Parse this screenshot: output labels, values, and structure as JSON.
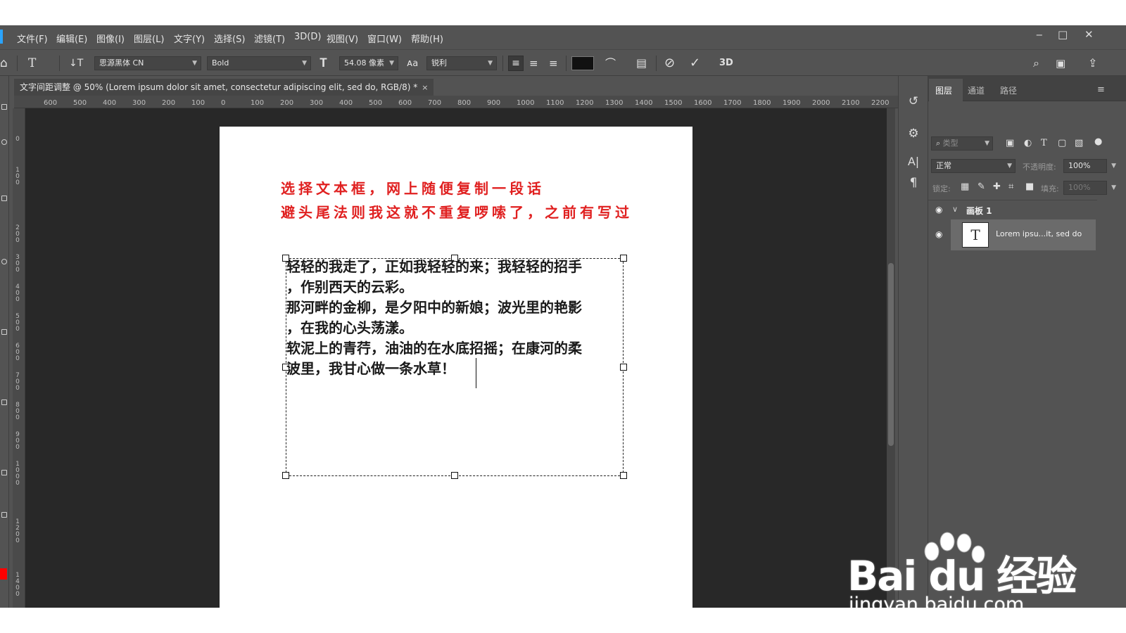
{
  "menubar": {
    "items": [
      "文件(F)",
      "编辑(E)",
      "图像(I)",
      "图层(L)",
      "文字(Y)",
      "选择(S)",
      "滤镜(T)",
      "3D(D)",
      "视图(V)",
      "窗口(W)",
      "帮助(H)"
    ],
    "window_controls": [
      "minimize-icon",
      "maximize-icon",
      "close-icon"
    ]
  },
  "options": {
    "font_family": "思源黑体 CN",
    "font_style": "Bold",
    "font_size": "54.08 像素",
    "aa_glyph": "a",
    "antialias": "锐利",
    "commit_3d": "3D",
    "text_color": "#111111"
  },
  "document": {
    "tab_title": "文字间距调整 @ 50% (Lorem ipsum dolor sit amet, consectetur adipiscing elit, sed do, RGB/8) *",
    "tab_close": "×"
  },
  "ruler": {
    "h_ticks": [
      "600",
      "500",
      "400",
      "300",
      "200",
      "100",
      "0",
      "100",
      "200",
      "300",
      "400",
      "500",
      "600",
      "700",
      "800",
      "900",
      "1000",
      "1100",
      "1200",
      "1300",
      "1400",
      "1500",
      "1600",
      "1700",
      "1800",
      "1900",
      "2000",
      "2100",
      "2200"
    ]
  },
  "artboard": {
    "heading_lines": [
      "选择文本框，网上随便复制一段话",
      "避头尾法则我这就不重复啰嗦了，之前有写过"
    ],
    "body_lines": [
      "轻轻的我走了，正如我轻轻的来；我轻轻的招手",
      "，作别西天的云彩。",
      "那河畔的金柳，是夕阳中的新娘；波光里的艳影",
      "，在我的心头荡漾。",
      "软泥上的青荇，油油的在水底招摇；在康河的柔",
      "波里，我甘心做一条水草！"
    ]
  },
  "layers_panel": {
    "tabs": [
      "图层",
      "通道",
      "路径"
    ],
    "filter_placeholder": "类型",
    "blend_mode": "正常",
    "opacity_label": "不透明度:",
    "opacity_value": "100%",
    "lock_label": "锁定:",
    "fill_label": "填充:",
    "fill_value": "100%",
    "artboard_layer": "画板 1",
    "text_layer": "Lorem ipsu...it, sed do",
    "text_layer_thumb": "T"
  },
  "watermark": {
    "brand": "Bai du 经验",
    "url": "jingyan.baidu.com"
  }
}
